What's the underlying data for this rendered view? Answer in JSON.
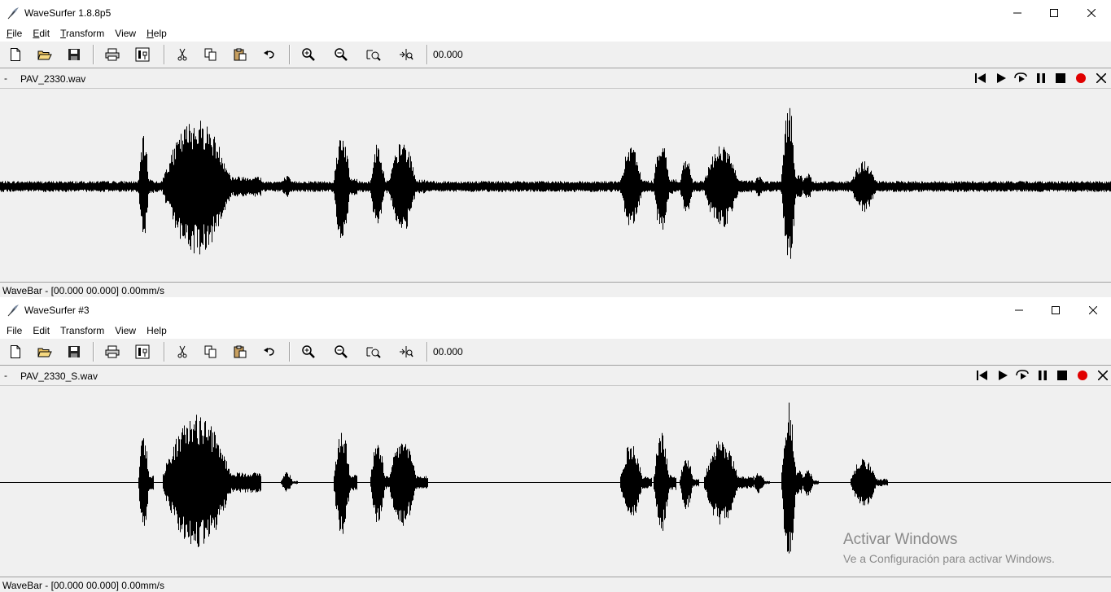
{
  "window1": {
    "title": "WaveSurfer 1.8.8p5",
    "menus": [
      {
        "label": "File",
        "ul": "F",
        "rest": "ile"
      },
      {
        "label": "Edit",
        "ul": "E",
        "rest": "dit"
      },
      {
        "label": "Transform",
        "ul": "T",
        "rest": "ransform"
      },
      {
        "label": "View",
        "ul": "",
        "rest": "View"
      },
      {
        "label": "Help",
        "ul": "H",
        "rest": "elp"
      }
    ],
    "time": "00.000",
    "file_name": "PAV_2330.wav",
    "collapse": "-",
    "status": "WaveBar - [00.000 00.000] 0.00mm/s"
  },
  "window2": {
    "title": "WaveSurfer #3",
    "menus": [
      {
        "label": "File"
      },
      {
        "label": "Edit"
      },
      {
        "label": "Transform"
      },
      {
        "label": "View"
      },
      {
        "label": "Help"
      }
    ],
    "time": "00.000",
    "file_name": "PAV_2330_S.wav",
    "collapse": "-",
    "status": "WaveBar - [00.000 00.000] 0.00mm/s"
  },
  "watermark": {
    "line1": "Activar Windows",
    "line2": "Ve a Configuración para activar Windows."
  },
  "icons": {
    "toolbar": [
      "new-file-icon",
      "open-folder-icon",
      "save-icon",
      "print-icon",
      "properties-icon",
      "cut-icon",
      "copy-icon",
      "paste-icon",
      "undo-icon",
      "zoom-in-icon",
      "zoom-out-icon",
      "zoom-fit-icon",
      "zoom-selection-icon"
    ],
    "transport": [
      "skip-to-start-icon",
      "play-icon",
      "loop-play-icon",
      "pause-icon",
      "stop-icon",
      "record-icon",
      "close-icon"
    ]
  },
  "colors": {
    "record": "#e00000",
    "waveform": "#000000",
    "background": "#f0f0f0"
  }
}
